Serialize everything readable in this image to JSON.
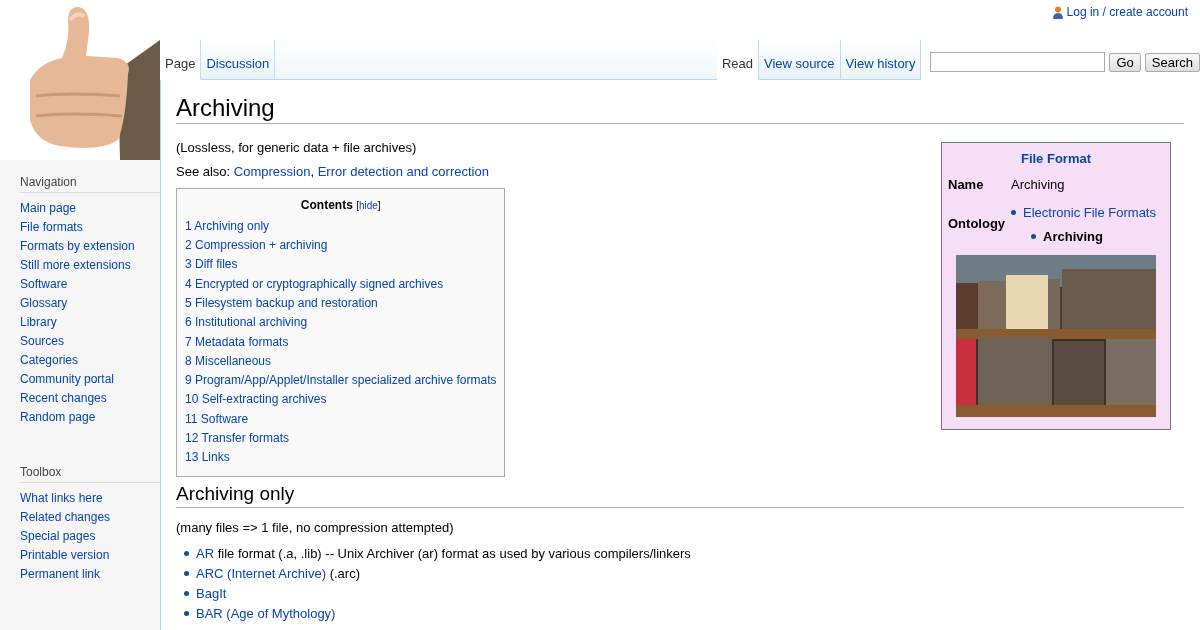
{
  "personal": {
    "login": "Log in / create account"
  },
  "left_tabs": [
    {
      "label": "Page",
      "selected": true
    },
    {
      "label": "Discussion",
      "selected": false
    }
  ],
  "right_tabs": [
    {
      "label": "Read",
      "selected": true
    },
    {
      "label": "View source",
      "selected": false
    },
    {
      "label": "View history",
      "selected": false
    }
  ],
  "search": {
    "buttons": [
      "Go",
      "Search"
    ]
  },
  "sidebar": [
    {
      "heading": "Navigation",
      "items": [
        "Main page",
        "File formats",
        "Formats by extension",
        "Still more extensions",
        "Software",
        "Glossary",
        "Library",
        "Sources",
        "Categories",
        "Community portal",
        "Recent changes",
        "Random page"
      ]
    },
    {
      "heading": "Toolbox",
      "items": [
        "What links here",
        "Related changes",
        "Special pages",
        "Printable version",
        "Permanent link"
      ]
    }
  ],
  "page": {
    "title": "Archiving",
    "intro": "(Lossless, for generic data + file archives)",
    "see_also": {
      "label": "See also:",
      "links": [
        "Compression",
        "Error detection and correction"
      ],
      "separator": ","
    },
    "toc": {
      "title": "Contents",
      "toggle": {
        "before": "[",
        "label": "hide",
        "after": "]"
      },
      "items": [
        {
          "number": "1",
          "label": "Archiving only"
        },
        {
          "number": "2",
          "label": "Compression + archiving"
        },
        {
          "number": "3",
          "label": "Diff files"
        },
        {
          "number": "4",
          "label": "Encrypted or cryptographically signed archives"
        },
        {
          "number": "5",
          "label": "Filesystem backup and restoration"
        },
        {
          "number": "6",
          "label": "Institutional archiving"
        },
        {
          "number": "7",
          "label": "Metadata formats"
        },
        {
          "number": "8",
          "label": "Miscellaneous"
        },
        {
          "number": "9",
          "label": "Program/App/Applet/Installer specialized archive formats"
        },
        {
          "number": "10",
          "label": "Self-extracting archives"
        },
        {
          "number": "11",
          "label": "Software"
        },
        {
          "number": "12",
          "label": "Transfer formats"
        },
        {
          "number": "13",
          "label": "Links"
        }
      ]
    },
    "infobox": {
      "title": "File Format",
      "rows": [
        {
          "label": "Name",
          "value": "Archiving"
        }
      ],
      "ontology": {
        "label": "Ontology",
        "items": [
          {
            "label": "Electronic File Formats",
            "kind": "link",
            "children": [
              {
                "label": "Archiving",
                "kind": "current"
              }
            ]
          }
        ]
      }
    },
    "sections": [
      {
        "heading": "Archiving only",
        "intro": "(many files => 1 file, no compression attempted)",
        "items": [
          {
            "link": "AR",
            "text": "file format (.a, .lib) -- Unix Archiver (ar) format as used by various compilers/linkers"
          },
          {
            "link": "ARC (Internet Archive)",
            "text": "(.arc)"
          },
          {
            "link": "BagIt"
          },
          {
            "link": "BAR (Age of Mythology)"
          }
        ]
      }
    ]
  }
}
